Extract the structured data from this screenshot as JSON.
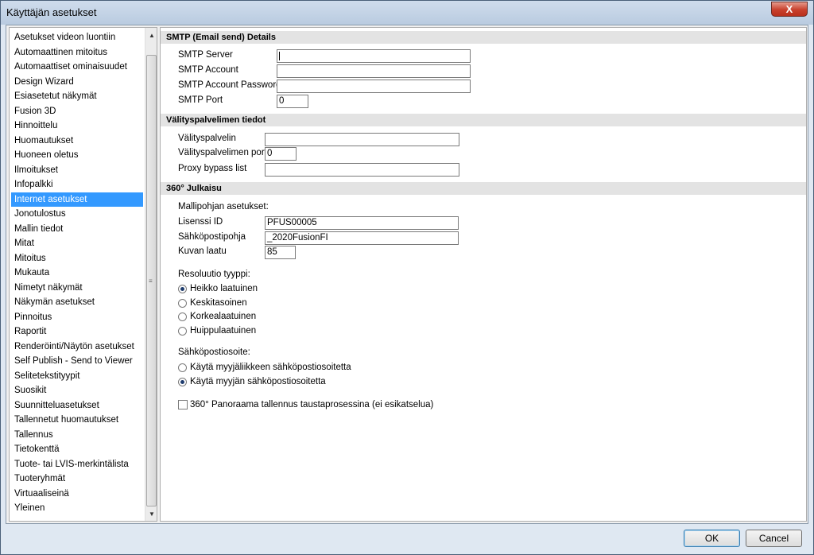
{
  "window": {
    "title": "Käyttäjän asetukset",
    "close_glyph": "X"
  },
  "sidebar": {
    "items": [
      "Asetukset videon luontiin",
      "Automaattinen mitoitus",
      "Automaattiset ominaisuudet",
      "Design Wizard",
      "Esiasetetut näkymät",
      "Fusion 3D",
      "Hinnoittelu",
      "Huomautukset",
      "Huoneen oletus",
      "Ilmoitukset",
      "Infopalkki",
      "Internet asetukset",
      "Jonotulostus",
      "Mallin tiedot",
      "Mitat",
      "Mitoitus",
      "Mukauta",
      "Nimetyt näkymät",
      "Näkymän asetukset",
      "Pinnoitus",
      "Raportit",
      "Renderöinti/Näytön asetukset",
      "Self Publish - Send to Viewer",
      "Selitetekstityypit",
      "Suosikit",
      "Suunnitteluasetukset",
      "Tallennetut huomautukset",
      "Tallennus",
      "Tietokenttä",
      "Tuote- tai LVIS-merkintälista",
      "Tuoteryhmät",
      "Virtuaaliseinä",
      "Yleinen"
    ],
    "selected_index": 11,
    "scroll_up_glyph": "▲",
    "scroll_down_glyph": "▼",
    "grip_glyph": "≡"
  },
  "smtp": {
    "header": "SMTP (Email send) Details",
    "server_label": "SMTP Server",
    "server_value": "",
    "account_label": "SMTP Account",
    "account_value": "",
    "password_label": "SMTP Account Password",
    "password_value": "",
    "port_label": "SMTP Port",
    "port_value": "0"
  },
  "proxy": {
    "header": "Välityspalvelimen tiedot",
    "server_label": "Välityspalvelin",
    "server_value": "",
    "port_label": "Välityspalvelimen portti",
    "port_value": "0",
    "bypass_label": "Proxy bypass list",
    "bypass_value": ""
  },
  "julkaisu": {
    "header": "360° Julkaisu",
    "template_label": "Mallipohjan asetukset:",
    "license_label": "Lisenssi ID",
    "license_value": "PFUS00005",
    "email_template_label": "Sähköpostipohja",
    "email_template_value": "_2020FusionFI",
    "quality_label": "Kuvan laatu",
    "quality_value": "85",
    "resolution_label": "Resoluutio tyyppi:",
    "resolution_options": [
      "Heikko laatuinen",
      "Keskitasoinen",
      "Korkealaatuinen",
      "Huippulaatuinen"
    ],
    "resolution_selected": 0,
    "email_label": "Sähköpostiosoite:",
    "email_options": [
      "Käytä myyjäliikkeen sähköpostiosoitetta",
      "Käytä myyjän sähköpostiosoitetta"
    ],
    "email_selected": 1,
    "panorama_label": "360° Panoraama tallennus taustaprosessina (ei esikatselua)",
    "panorama_checked": false
  },
  "buttons": {
    "ok": "OK",
    "cancel": "Cancel"
  },
  "colors": {
    "selection": "#3399ff",
    "section_header": "#e3e3e3"
  }
}
